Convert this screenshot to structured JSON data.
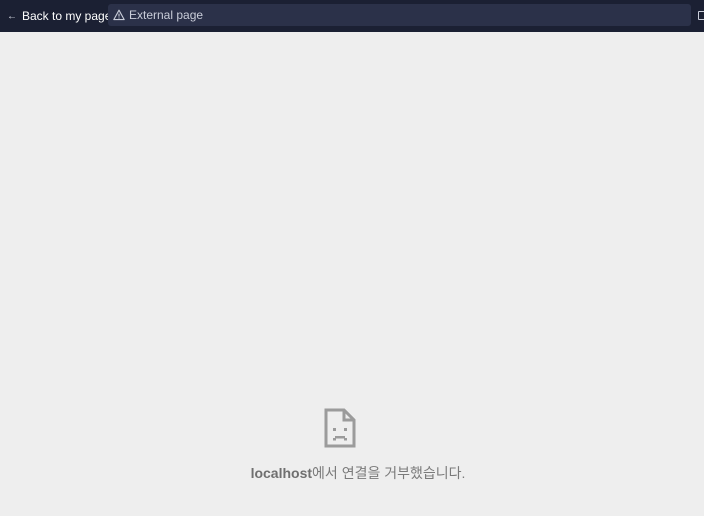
{
  "topbar": {
    "back_label": "Back to my page",
    "url_text": "External page",
    "icons": {
      "back": "arrow-left-icon",
      "warning": "warning-triangle-icon",
      "copy": "copy-icon"
    }
  },
  "error": {
    "icon": "sad-page-icon",
    "host": "localhost",
    "message": "에서 연결을 거부했습니다."
  },
  "colors": {
    "topbar_bg": "#1b2033",
    "urlbar_bg": "#2b3149",
    "page_bg": "#eeeeee",
    "error_text": "#7a7a7a"
  }
}
